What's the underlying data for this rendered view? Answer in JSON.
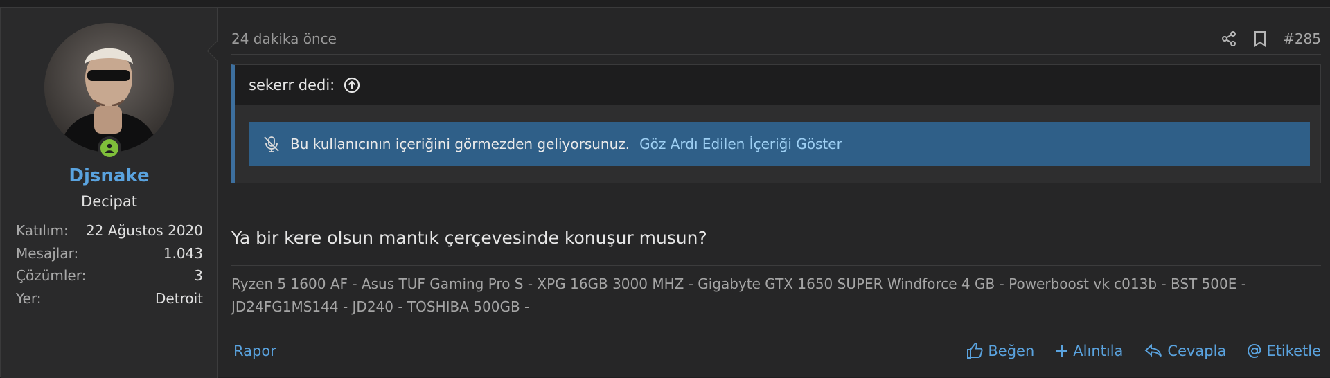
{
  "user": {
    "name": "Djsnake",
    "title": "Decipat",
    "online": true,
    "stats": [
      {
        "key": "Katılım:",
        "value": "22 Ağustos 2020"
      },
      {
        "key": "Mesajlar:",
        "value": "1.043"
      },
      {
        "key": "Çözümler:",
        "value": "3"
      },
      {
        "key": "Yer:",
        "value": "Detroit"
      }
    ]
  },
  "post": {
    "time": "24 dakika önce",
    "number": "#285",
    "quote": {
      "author_line": "sekerr dedi:",
      "ignored_text": "Bu kullanıcının içeriğini görmezden geliyorsunuz.",
      "ignored_link": "Göz Ardı Edilen İçeriği Göster"
    },
    "body": "Ya bir kere olsun mantık çerçevesinde konuşur musun?",
    "signature_line1": "Ryzen 5 1600 AF - Asus TUF Gaming Pro S - XPG 16GB 3000 MHZ - Gigabyte GTX 1650 SUPER Windforce 4 GB - Powerboost vk c013b - BST 500E -",
    "signature_line2": "JD24FG1MS144 - JD240 - TOSHIBA 500GB -"
  },
  "actions": {
    "report": "Rapor",
    "like": "Beğen",
    "quote": "Alıntıla",
    "reply": "Cevapla",
    "tag": "Etiketle"
  },
  "colors": {
    "link": "#5aa3df",
    "ignored_bg": "#2f5f88",
    "quote_border": "#3d6f9e",
    "online": "#7fbf3a"
  }
}
